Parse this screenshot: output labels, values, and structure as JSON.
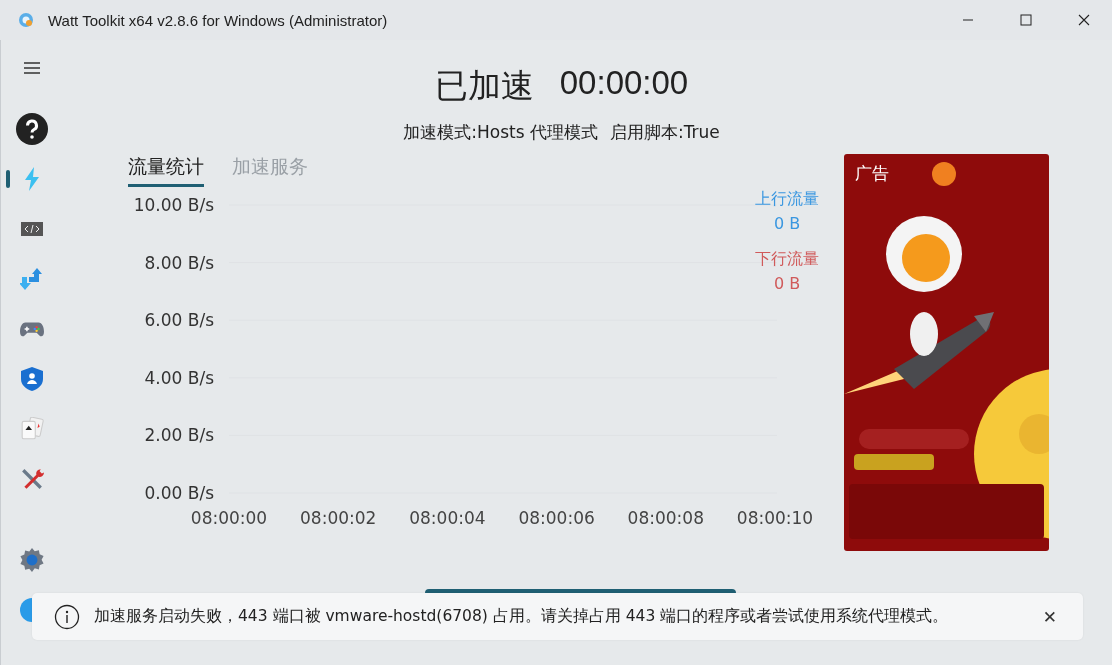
{
  "window": {
    "title": "Watt Toolkit x64 v2.8.6 for Windows (Administrator)"
  },
  "sidebar": {
    "items": [
      {
        "selected": false
      },
      {
        "selected": true
      },
      {
        "selected": false
      },
      {
        "selected": false
      },
      {
        "selected": false
      },
      {
        "selected": false
      },
      {
        "selected": false
      },
      {
        "selected": false
      }
    ],
    "bottom_items": [
      {
        "selected": false
      },
      {
        "selected": false
      }
    ]
  },
  "status": {
    "title": "已加速",
    "timer": "00:00:00",
    "mode_label": "加速模式:",
    "mode": "Hosts 代理模式",
    "script_label": "启用脚本:",
    "script": "True"
  },
  "tabs": [
    {
      "label": "流量统计",
      "selected": true
    },
    {
      "label": "加速服务",
      "selected": false
    }
  ],
  "chart_data": {
    "type": "line",
    "categories": [
      "08:00:00",
      "08:00:02",
      "08:00:04",
      "08:00:06",
      "08:00:08",
      "08:00:10"
    ],
    "ylim": [
      0,
      10
    ],
    "yticks": [
      {
        "value": 0,
        "label": "0.00 B/s"
      },
      {
        "value": 2,
        "label": "2.00 B/s"
      },
      {
        "value": 4,
        "label": "4.00 B/s"
      },
      {
        "value": 6,
        "label": "6.00 B/s"
      },
      {
        "value": 8,
        "label": "8.00 B/s"
      },
      {
        "value": 10,
        "label": "10.00 B/s"
      }
    ],
    "series": [
      {
        "name": "上行流量",
        "color": "#3a97e0",
        "values": [
          null,
          null,
          null,
          null,
          null,
          null
        ]
      },
      {
        "name": "下行流量",
        "color": "#d05a5a",
        "values": [
          null,
          null,
          null,
          null,
          null,
          null
        ]
      }
    ]
  },
  "legend": [
    {
      "total": "0 B"
    },
    {
      "total": "0 B"
    }
  ],
  "ad": {
    "label": "广告",
    "kind": "picture"
  },
  "toast": {
    "message": "加速服务启动失败，443 端口被 vmware-hostd(6708) 占用。请关掉占用 443 端口的程序或者尝试使用系统代理模式。",
    "close": "✕"
  }
}
